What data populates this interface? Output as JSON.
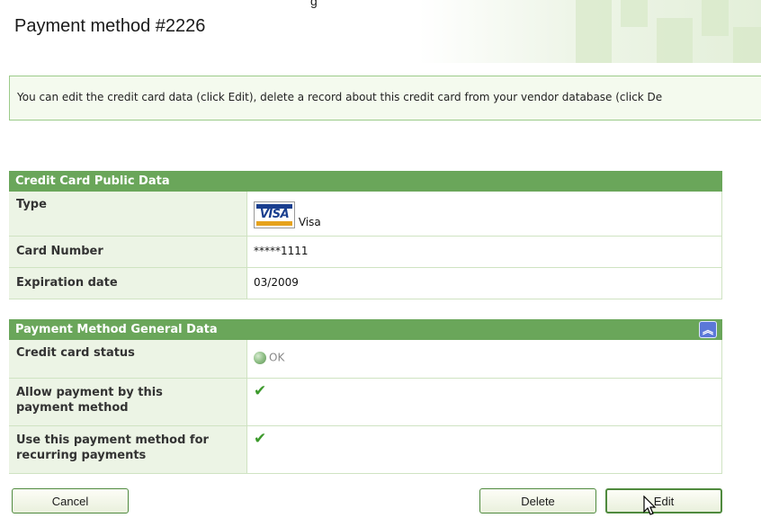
{
  "page": {
    "title": "Payment method #2226",
    "top_fragment": "g"
  },
  "notice": {
    "text": "You can edit the credit card data (click Edit), delete a record about this credit card from your vendor database (click De"
  },
  "public_data": {
    "heading": "Credit Card Public Data",
    "rows": [
      {
        "label": "Type",
        "value": "Visa",
        "icon": "visa-logo-icon",
        "logo_text": "VISA"
      },
      {
        "label": "Card Number",
        "value": "*****1111"
      },
      {
        "label": "Expiration date",
        "value": "03/2009"
      }
    ]
  },
  "general_data": {
    "heading": "Payment Method General Data",
    "collapse_icon": "double-chevron-up-icon",
    "rows": [
      {
        "label": "Credit card status",
        "value": "OK",
        "icon": "green-status-dot-icon"
      },
      {
        "label": "Allow payment by this payment method",
        "value": "",
        "icon": "checkmark-icon"
      },
      {
        "label": "Use this payment method for recurring payments",
        "value": "",
        "icon": "checkmark-icon"
      }
    ]
  },
  "buttons": {
    "cancel": "Cancel",
    "delete": "Delete",
    "edit": "Edit"
  },
  "colors": {
    "panel_header": "#6aa65a",
    "label_bg": "#ecf4e5",
    "notice_border": "#9ccb8a",
    "check": "#3d9a2d",
    "collapse_button": "#5b78d8"
  }
}
